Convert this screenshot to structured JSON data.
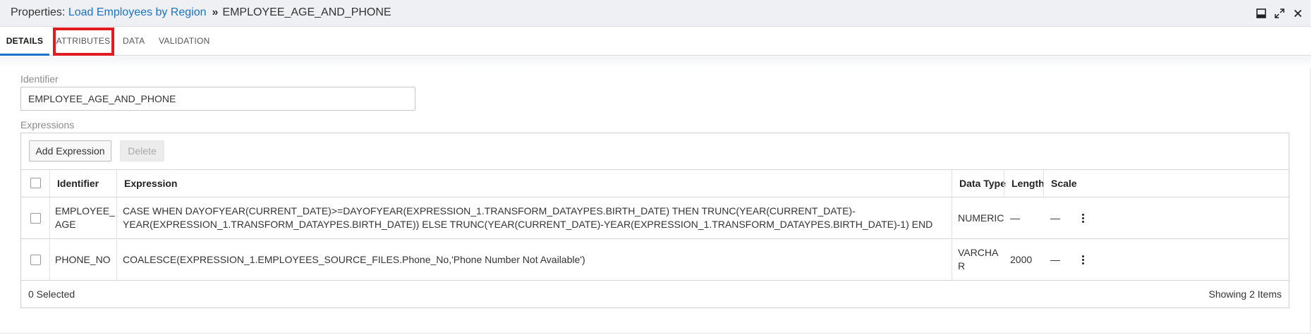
{
  "header": {
    "prefix": "Properties: ",
    "link": "Load Employees by Region",
    "separator": "»",
    "object": "EMPLOYEE_AGE_AND_PHONE",
    "icons": [
      "minimize-panel-icon",
      "expand-icon",
      "close-icon"
    ]
  },
  "tabs": [
    {
      "label": "DETAILS",
      "active": true
    },
    {
      "label": "ATTRIBUTES",
      "active": false
    },
    {
      "label": "DATA",
      "active": false
    },
    {
      "label": "VALIDATION",
      "active": false
    }
  ],
  "identifier": {
    "label": "Identifier",
    "value": "EMPLOYEE_AGE_AND_PHONE"
  },
  "expressions": {
    "label": "Expressions",
    "add_label": "Add Expression",
    "delete_label": "Delete",
    "columns": [
      "Identifier",
      "Expression",
      "Data Type",
      "Length",
      "Scale"
    ],
    "rows": [
      {
        "identifier_line1": "EMPLOYEE_",
        "identifier_line2": "AGE",
        "expression_line1": "CASE WHEN DAYOFYEAR(CURRENT_DATE)>=DAYOFYEAR(EXPRESSION_1.TRANSFORM_DATAYPES.BIRTH_DATE) THEN TRUNC(YEAR(CURRENT_DATE)-",
        "expression_line2": "YEAR(EXPRESSION_1.TRANSFORM_DATAYPES.BIRTH_DATE)) ELSE TRUNC(YEAR(CURRENT_DATE)-YEAR(EXPRESSION_1.TRANSFORM_DATAYPES.BIRTH_DATE)-1) END",
        "data_type_line1": "NUMERIC",
        "data_type_line2": "",
        "length": "—",
        "scale": "—"
      },
      {
        "identifier_line1": "PHONE_NO",
        "identifier_line2": "",
        "expression_line1": "COALESCE(EXPRESSION_1.EMPLOYEES_SOURCE_FILES.Phone_No,'Phone Number Not Available')",
        "expression_line2": "",
        "data_type_line1": "VARCHA",
        "data_type_line2": "R",
        "length": "2000",
        "scale": "—"
      }
    ],
    "footer_selected": "0 Selected",
    "footer_count": "Showing 2 Items"
  }
}
